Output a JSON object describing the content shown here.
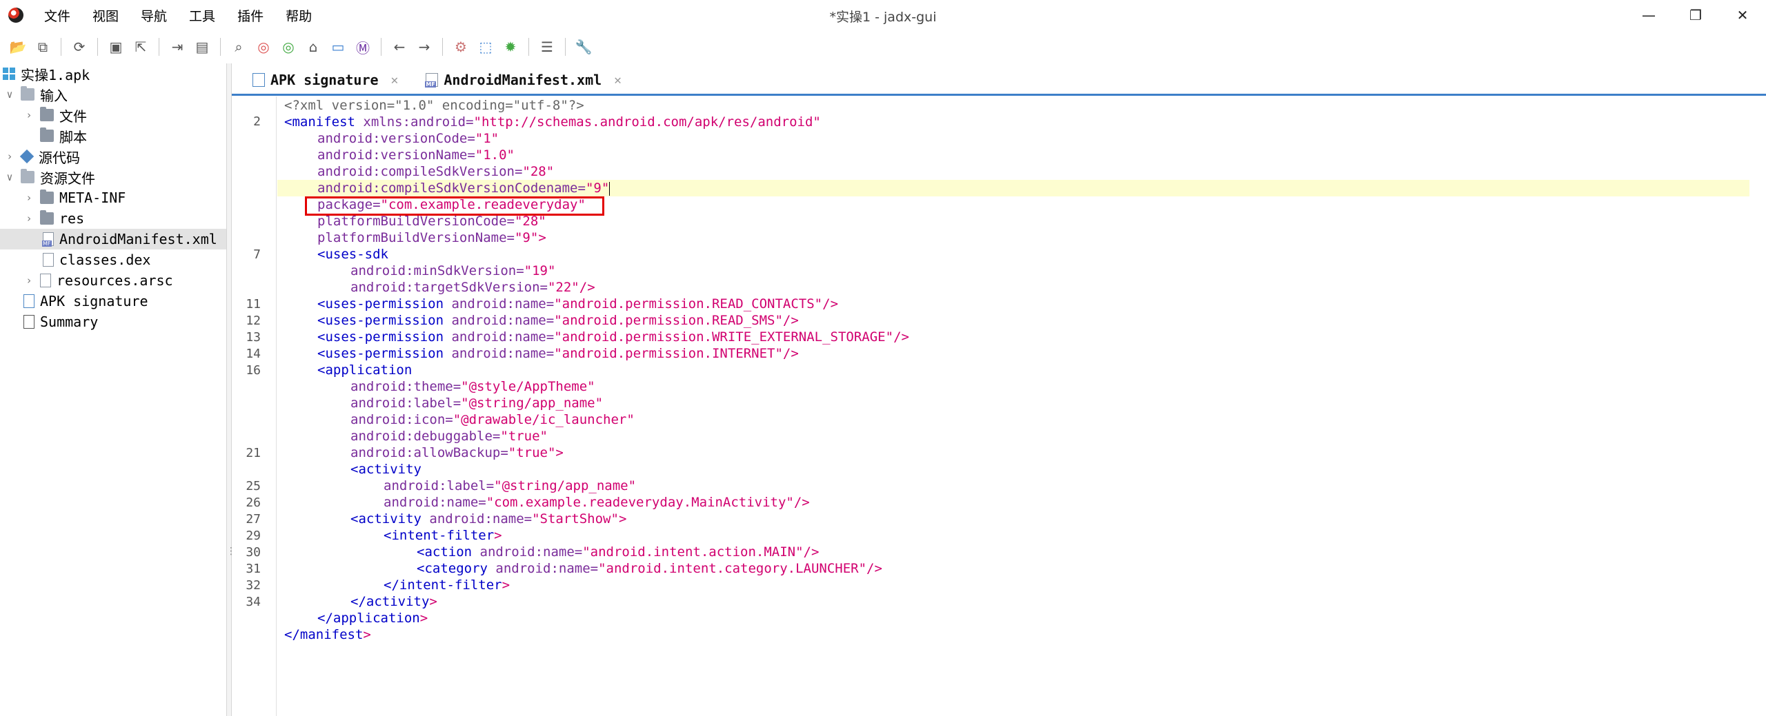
{
  "window": {
    "title": "*实操1 - jadx-gui",
    "controls": {
      "minimize": "—",
      "maximize": "❐",
      "close": "✕"
    }
  },
  "menu": [
    "文件",
    "视图",
    "导航",
    "工具",
    "插件",
    "帮助"
  ],
  "toolbar": {
    "icons": [
      "open-icon",
      "add-files-icon",
      "sync-icon",
      "save-icon",
      "export-icon",
      "deobf-icon",
      "show-folder-icon",
      "search-icon",
      "find-class-icon",
      "find-usage-icon",
      "home-icon",
      "quark-icon",
      "smali-icon",
      "back-icon",
      "forward-icon",
      "log-icon",
      "decompile-icon",
      "debug-icon",
      "list-icon",
      "settings-icon"
    ]
  },
  "tree": {
    "root": "实操1.apk",
    "input": "输入",
    "files": "文件",
    "scripts": "脚本",
    "source": "源代码",
    "resources": "资源文件",
    "meta_inf": "META-INF",
    "res": "res",
    "manifest": "AndroidManifest.xml",
    "classes": "classes.dex",
    "arsc": "resources.arsc",
    "apk_signature": "APK signature",
    "summary": "Summary"
  },
  "tabs": [
    {
      "label": "APK signature",
      "close": "✕"
    },
    {
      "label": "AndroidManifest.xml",
      "close": "✕"
    }
  ],
  "editor": {
    "line_numbers": [
      "2",
      "7",
      "11",
      "12",
      "13",
      "14",
      "16",
      "21",
      "25",
      "26",
      "27",
      "29",
      "30",
      "31",
      "32",
      "34"
    ],
    "lines": {
      "l0": "<?xml version=\"1.0\" encoding=\"utf-8\"?>",
      "l1_tag": "<manifest",
      "l1_attr": " xmlns:android=",
      "l1_val": "\"http://schemas.android.com/apk/res/android\"",
      "l2_attr": "android:versionCode=",
      "l2_val": "\"1\"",
      "l3_attr": "android:versionName=",
      "l3_val": "\"1.0\"",
      "l4_attr": "android:compileSdkVersion=",
      "l4_val": "\"28\"",
      "l5_attr": "android:compileSdkVersionCodename=",
      "l5_val": "\"9\"",
      "l6_attr": "package=",
      "l6_val": "\"com.example.readeveryday\"",
      "l7_attr": "platformBuildVersionCode=",
      "l7_val": "\"28\"",
      "l8_attr": "platformBuildVersionName=",
      "l8_val": "\"9\"",
      "l8_end": ">",
      "l9_tag": "<uses-sdk",
      "l10_attr": "android:minSdkVersion=",
      "l10_val": "\"19\"",
      "l11_attr": "android:targetSdkVersion=",
      "l11_val": "\"22\"",
      "l11_end": "/>",
      "l12_tag": "<uses-permission",
      "l12_attr": " android:name=",
      "l12_val": "\"android.permission.READ_CONTACTS\"",
      "l12_end": "/>",
      "l13_tag": "<uses-permission",
      "l13_attr": " android:name=",
      "l13_val": "\"android.permission.READ_SMS\"",
      "l13_end": "/>",
      "l14_tag": "<uses-permission",
      "l14_attr": " android:name=",
      "l14_val": "\"android.permission.WRITE_EXTERNAL_STORAGE\"",
      "l14_end": "/>",
      "l15_tag": "<uses-permission",
      "l15_attr": " android:name=",
      "l15_val": "\"android.permission.INTERNET\"",
      "l15_end": "/>",
      "l16_tag": "<application",
      "l17_attr": "android:theme=",
      "l17_val": "\"@style/AppTheme\"",
      "l18_attr": "android:label=",
      "l18_val": "\"@string/app_name\"",
      "l19_attr": "android:icon=",
      "l19_val": "\"@drawable/ic_launcher\"",
      "l20_attr": "android:debuggable=",
      "l20_val": "\"true\"",
      "l21_attr": "android:allowBackup=",
      "l21_val": "\"true\"",
      "l21_end": ">",
      "l22_tag": "<activity",
      "l23_attr": "android:label=",
      "l23_val": "\"@string/app_name\"",
      "l24_attr": "android:name=",
      "l24_val": "\"com.example.readeveryday.MainActivity\"",
      "l24_end": "/>",
      "l25_tag": "<activity",
      "l25_attr": " android:name=",
      "l25_val": "\"StartShow\"",
      "l25_end": ">",
      "l26_tag": "<intent-filter",
      "l26_end": ">",
      "l27_tag": "<action",
      "l27_attr": " android:name=",
      "l27_val": "\"android.intent.action.MAIN\"",
      "l27_end": "/>",
      "l28_tag": "<category",
      "l28_attr": " android:name=",
      "l28_val": "\"android.intent.category.LAUNCHER\"",
      "l28_end": "/>",
      "l29_tag": "</intent-filter",
      "l29_end": ">",
      "l30_tag": "</activity",
      "l30_end": ">",
      "l31_tag": "</application",
      "l31_end": ">",
      "l32_tag": "</manifest",
      "l32_end": ">"
    }
  },
  "colors": {
    "tag": "#0000c8",
    "attribute": "#7a2c9a",
    "value": "#d1006f",
    "highlight_line": "#fdfdd0",
    "annotation_box": "#e30000",
    "tab_accent": "#3d7fc9"
  }
}
